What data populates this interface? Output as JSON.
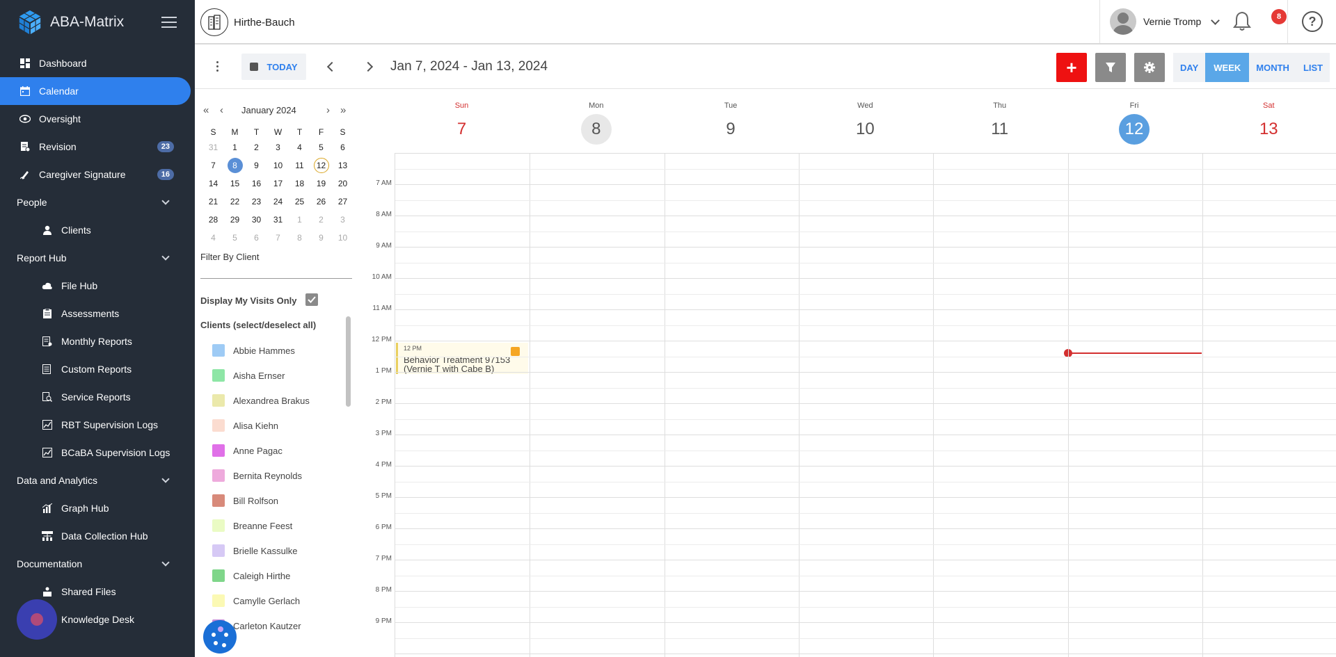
{
  "app": {
    "name": "ABA-Matrix"
  },
  "sidebar": {
    "items": [
      {
        "label": "Dashboard",
        "icon": "dashboard-icon"
      },
      {
        "label": "Calendar",
        "icon": "calendar-icon",
        "active": true
      },
      {
        "label": "Oversight",
        "icon": "eye-icon"
      },
      {
        "label": "Revision",
        "icon": "revision-icon",
        "badge": "23"
      },
      {
        "label": "Caregiver Signature",
        "icon": "signature-icon",
        "badge": "16"
      }
    ],
    "sections": {
      "people": {
        "label": "People",
        "items": [
          {
            "label": "Clients"
          }
        ]
      },
      "report_hub": {
        "label": "Report Hub",
        "items": [
          {
            "label": "File Hub"
          },
          {
            "label": "Assessments"
          },
          {
            "label": "Monthly Reports"
          },
          {
            "label": "Custom Reports"
          },
          {
            "label": "Service Reports"
          },
          {
            "label": "RBT Supervision Logs"
          },
          {
            "label": "BCaBA Supervision Logs"
          }
        ]
      },
      "data_analytics": {
        "label": "Data and Analytics",
        "items": [
          {
            "label": "Graph Hub"
          },
          {
            "label": "Data Collection Hub"
          }
        ]
      },
      "documentation": {
        "label": "Documentation",
        "items": [
          {
            "label": "Shared Files"
          },
          {
            "label": "Knowledge Desk"
          }
        ]
      }
    }
  },
  "topbar": {
    "org_name": "Hirthe-Bauch",
    "user_name": "Vernie Tromp",
    "notification_count": "8",
    "help_symbol": "?"
  },
  "toolbar": {
    "today_label": "TODAY",
    "date_range": "Jan 7, 2024 - Jan 13, 2024",
    "add_symbol": "+",
    "views": [
      "DAY",
      "WEEK",
      "MONTH",
      "LIST"
    ],
    "active_view": "WEEK"
  },
  "mini_calendar": {
    "title": "January 2024",
    "nav": {
      "prev_year": "«",
      "prev_month": "‹",
      "next_month": "›",
      "next_year": "»"
    },
    "dow": [
      "S",
      "M",
      "T",
      "W",
      "T",
      "F",
      "S"
    ],
    "weeks": [
      [
        "31",
        "1",
        "2",
        "3",
        "4",
        "5",
        "6"
      ],
      [
        "7",
        "8",
        "9",
        "10",
        "11",
        "12",
        "13"
      ],
      [
        "14",
        "15",
        "16",
        "17",
        "18",
        "19",
        "20"
      ],
      [
        "21",
        "22",
        "23",
        "24",
        "25",
        "26",
        "27"
      ],
      [
        "28",
        "29",
        "30",
        "31",
        "1",
        "2",
        "3"
      ],
      [
        "4",
        "5",
        "6",
        "7",
        "8",
        "9",
        "10"
      ]
    ]
  },
  "filters": {
    "filter_by_client": "Filter By Client",
    "display_my_visits": "Display My Visits Only",
    "clients_header": "Clients (select/deselect all)",
    "clients": [
      {
        "name": "Abbie Hammes",
        "color": "#9ecbf5"
      },
      {
        "name": "Aisha Ernser",
        "color": "#8ee6a6"
      },
      {
        "name": "Alexandrea Brakus",
        "color": "#ebe9ab"
      },
      {
        "name": "Alisa Kiehn",
        "color": "#fbdcd0"
      },
      {
        "name": "Anne Pagac",
        "color": "#e070e8"
      },
      {
        "name": "Bernita Reynolds",
        "color": "#eeaadc"
      },
      {
        "name": "Bill Rolfson",
        "color": "#d88a7a"
      },
      {
        "name": "Breanne Feest",
        "color": "#eafbc4"
      },
      {
        "name": "Brielle Kassulke",
        "color": "#d6c9f5"
      },
      {
        "name": "Caleigh Hirthe",
        "color": "#7fd68a"
      },
      {
        "name": "Camylle Gerlach",
        "color": "#fbf9b4"
      },
      {
        "name": "Carleton Kautzer",
        "color": "#c48ad8"
      }
    ]
  },
  "calendar": {
    "days": [
      {
        "name": "Sun",
        "num": "7"
      },
      {
        "name": "Mon",
        "num": "8"
      },
      {
        "name": "Tue",
        "num": "9"
      },
      {
        "name": "Wed",
        "num": "10"
      },
      {
        "name": "Thu",
        "num": "11"
      },
      {
        "name": "Fri",
        "num": "12"
      },
      {
        "name": "Sat",
        "num": "13"
      }
    ],
    "time_labels": [
      "7 AM",
      "8 AM",
      "9 AM",
      "10 AM",
      "11 AM",
      "12 PM",
      "1 PM",
      "2 PM",
      "3 PM",
      "4 PM",
      "5 PM",
      "6 PM",
      "7 PM",
      "8 PM",
      "9 PM"
    ],
    "event": {
      "time": "12 PM",
      "title": "Behavior Treatment 97153 (Vernie T with Cabe B)",
      "day": "Sun"
    }
  }
}
